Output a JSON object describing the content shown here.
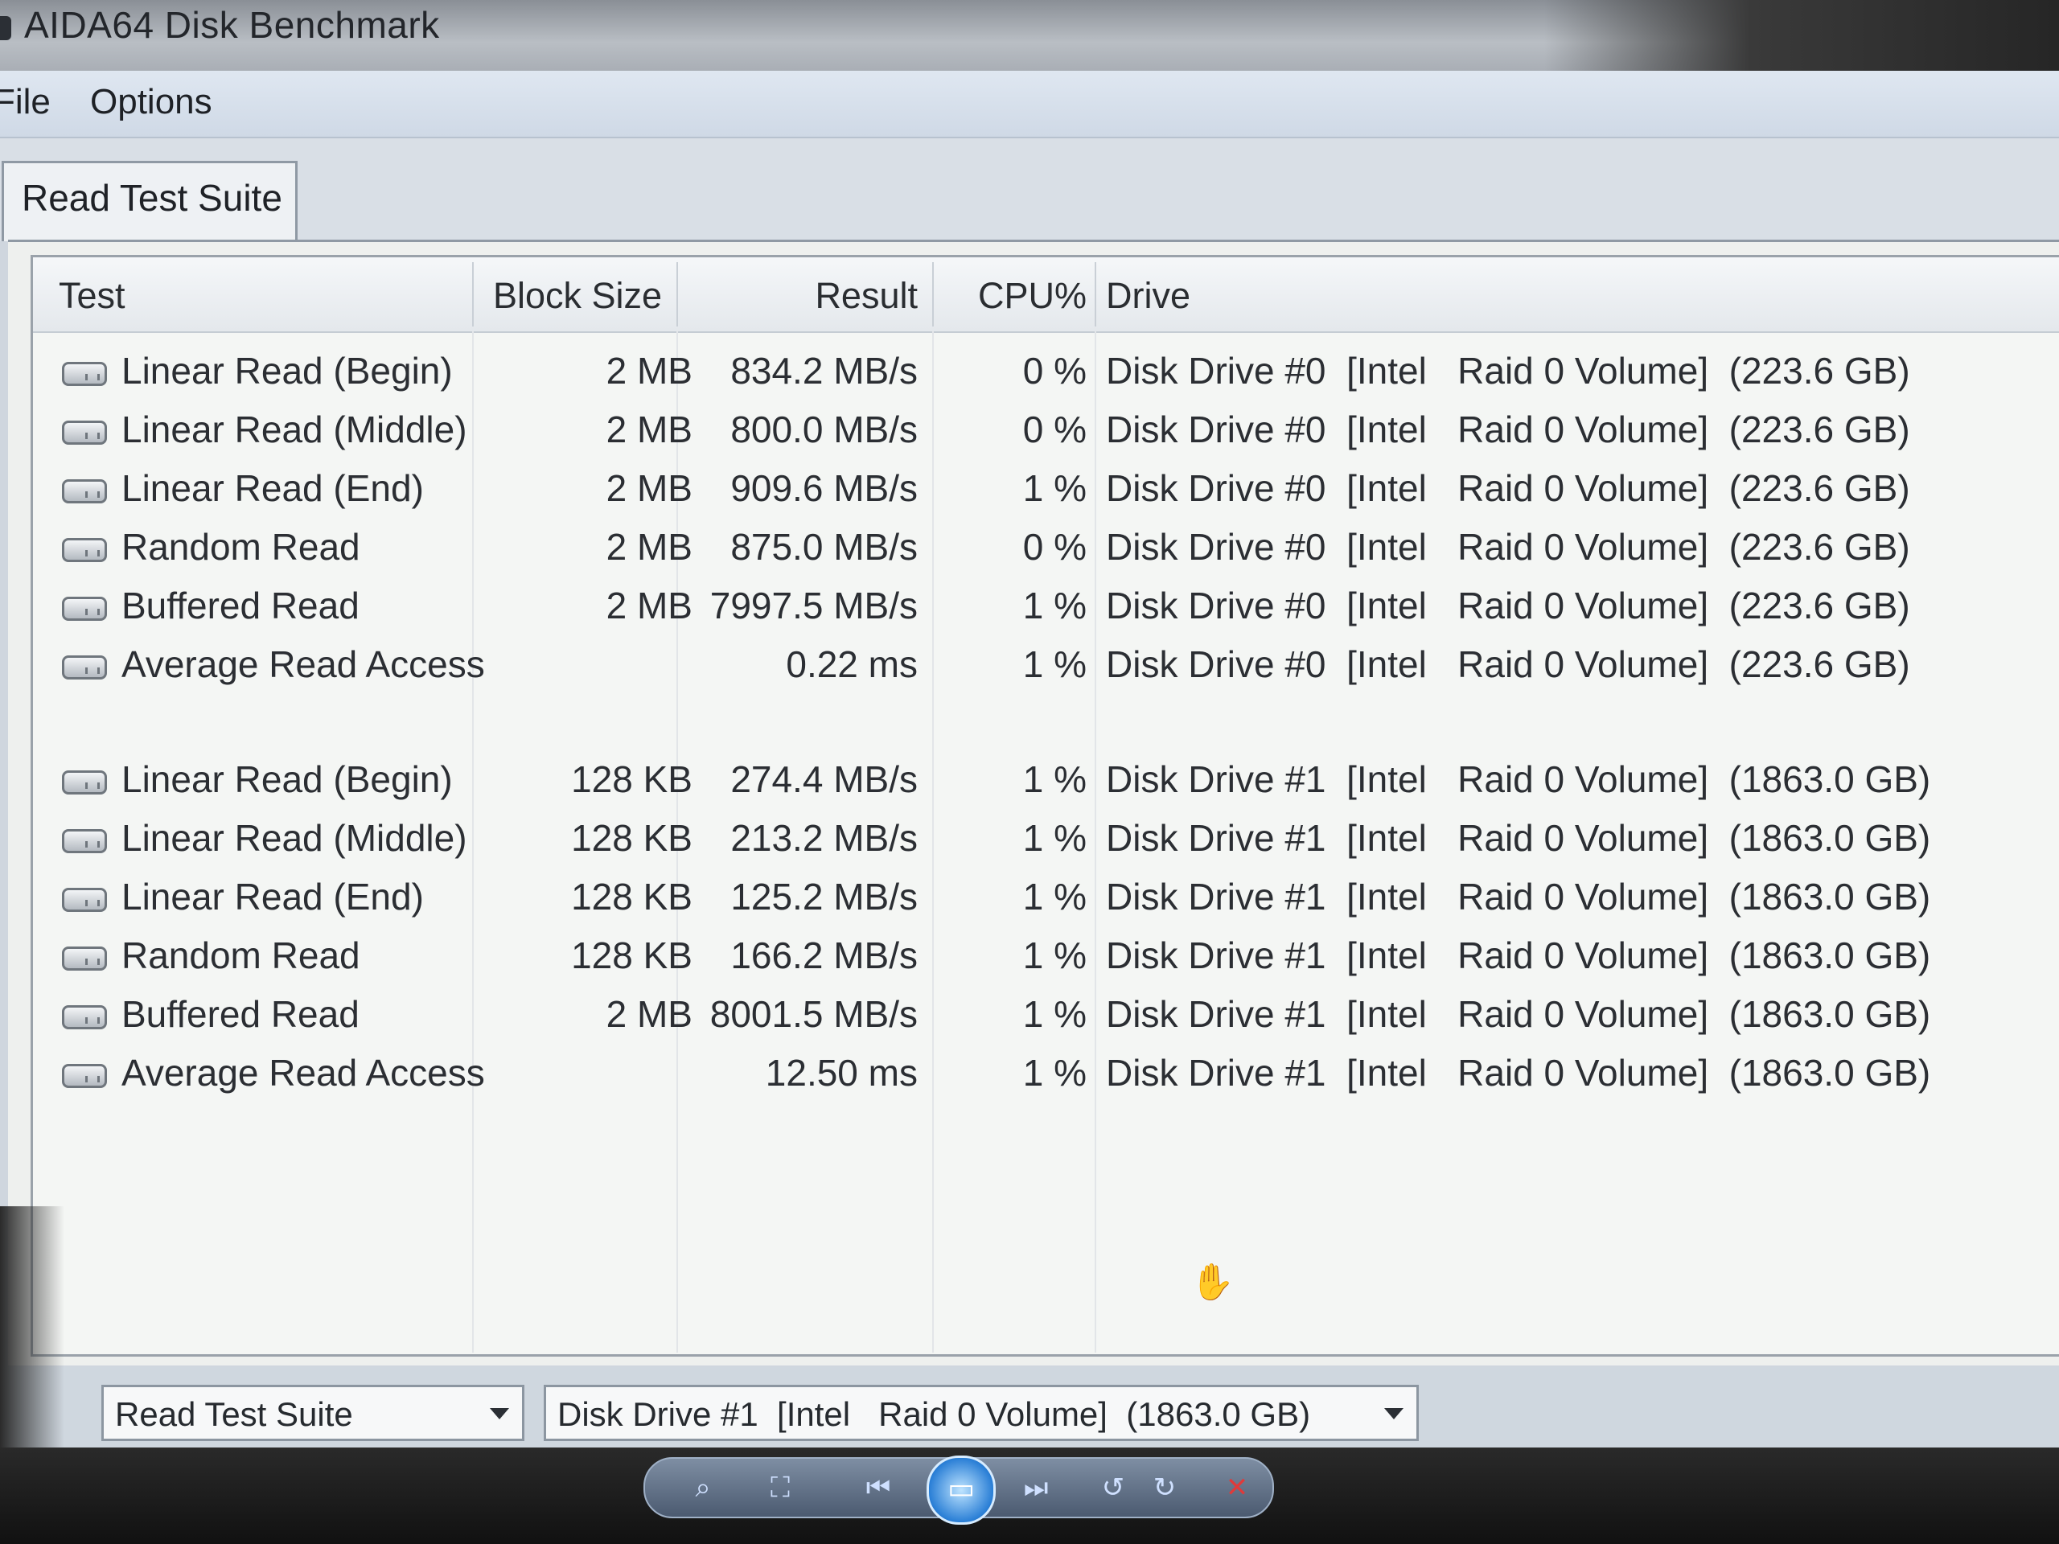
{
  "window": {
    "title": "AIDA64 Disk Benchmark"
  },
  "menu": {
    "items": [
      {
        "label": "File"
      },
      {
        "label": "Options"
      }
    ]
  },
  "tab": {
    "label": "Read Test Suite"
  },
  "table": {
    "headers": {
      "test": "Test",
      "block_size": "Block Size",
      "result": "Result",
      "cpu": "CPU%",
      "drive": "Drive"
    },
    "rows": [
      {
        "test": "Linear Read (Begin)",
        "block": "2 MB",
        "result": "834.2 MB/s",
        "cpu": "0 %",
        "drive": "Disk Drive #0  [Intel   Raid 0 Volume]  (223.6 GB)"
      },
      {
        "test": "Linear Read (Middle)",
        "block": "2 MB",
        "result": "800.0 MB/s",
        "cpu": "0 %",
        "drive": "Disk Drive #0  [Intel   Raid 0 Volume]  (223.6 GB)"
      },
      {
        "test": "Linear Read (End)",
        "block": "2 MB",
        "result": "909.6 MB/s",
        "cpu": "1 %",
        "drive": "Disk Drive #0  [Intel   Raid 0 Volume]  (223.6 GB)"
      },
      {
        "test": "Random Read",
        "block": "2 MB",
        "result": "875.0 MB/s",
        "cpu": "0 %",
        "drive": "Disk Drive #0  [Intel   Raid 0 Volume]  (223.6 GB)"
      },
      {
        "test": "Buffered Read",
        "block": "2 MB",
        "result": "7997.5 MB/s",
        "cpu": "1 %",
        "drive": "Disk Drive #0  [Intel   Raid 0 Volume]  (223.6 GB)"
      },
      {
        "test": "Average Read Access",
        "block": "",
        "result": "0.22 ms",
        "cpu": "1 %",
        "drive": "Disk Drive #0  [Intel   Raid 0 Volume]  (223.6 GB)"
      },
      {
        "test": "Linear Read (Begin)",
        "block": "128 KB",
        "result": "274.4 MB/s",
        "cpu": "1 %",
        "drive": "Disk Drive #1  [Intel   Raid 0 Volume]  (1863.0 GB)"
      },
      {
        "test": "Linear Read (Middle)",
        "block": "128 KB",
        "result": "213.2 MB/s",
        "cpu": "1 %",
        "drive": "Disk Drive #1  [Intel   Raid 0 Volume]  (1863.0 GB)"
      },
      {
        "test": "Linear Read (End)",
        "block": "128 KB",
        "result": "125.2 MB/s",
        "cpu": "1 %",
        "drive": "Disk Drive #1  [Intel   Raid 0 Volume]  (1863.0 GB)"
      },
      {
        "test": "Random Read",
        "block": "128 KB",
        "result": "166.2 MB/s",
        "cpu": "1 %",
        "drive": "Disk Drive #1  [Intel   Raid 0 Volume]  (1863.0 GB)"
      },
      {
        "test": "Buffered Read",
        "block": "2 MB",
        "result": "8001.5 MB/s",
        "cpu": "1 %",
        "drive": "Disk Drive #1  [Intel   Raid 0 Volume]  (1863.0 GB)"
      },
      {
        "test": "Average Read Access",
        "block": "",
        "result": "12.50 ms",
        "cpu": "1 %",
        "drive": "Disk Drive #1  [Intel   Raid 0 Volume]  (1863.0 GB)"
      }
    ]
  },
  "controls": {
    "suite_select": "Read Test Suite",
    "drive_select": "Disk Drive #1  [Intel   Raid 0 Volume]  (1863.0 GB)"
  },
  "viewer": {
    "buttons": [
      {
        "icon": "zoom-icon",
        "glyph": "⌕"
      },
      {
        "icon": "fit-icon",
        "glyph": "⛶"
      },
      {
        "icon": "previous-icon",
        "glyph": "⏮"
      },
      {
        "icon": "slideshow-icon",
        "glyph": "▭"
      },
      {
        "icon": "next-icon",
        "glyph": "⏭"
      },
      {
        "icon": "rotate-left-icon",
        "glyph": "↺"
      },
      {
        "icon": "rotate-right-icon",
        "glyph": "↻"
      },
      {
        "icon": "delete-icon",
        "glyph": "✕"
      }
    ]
  },
  "colors": {
    "accent_blue": "#2a7fd6",
    "delete_red": "#e03a3a"
  }
}
